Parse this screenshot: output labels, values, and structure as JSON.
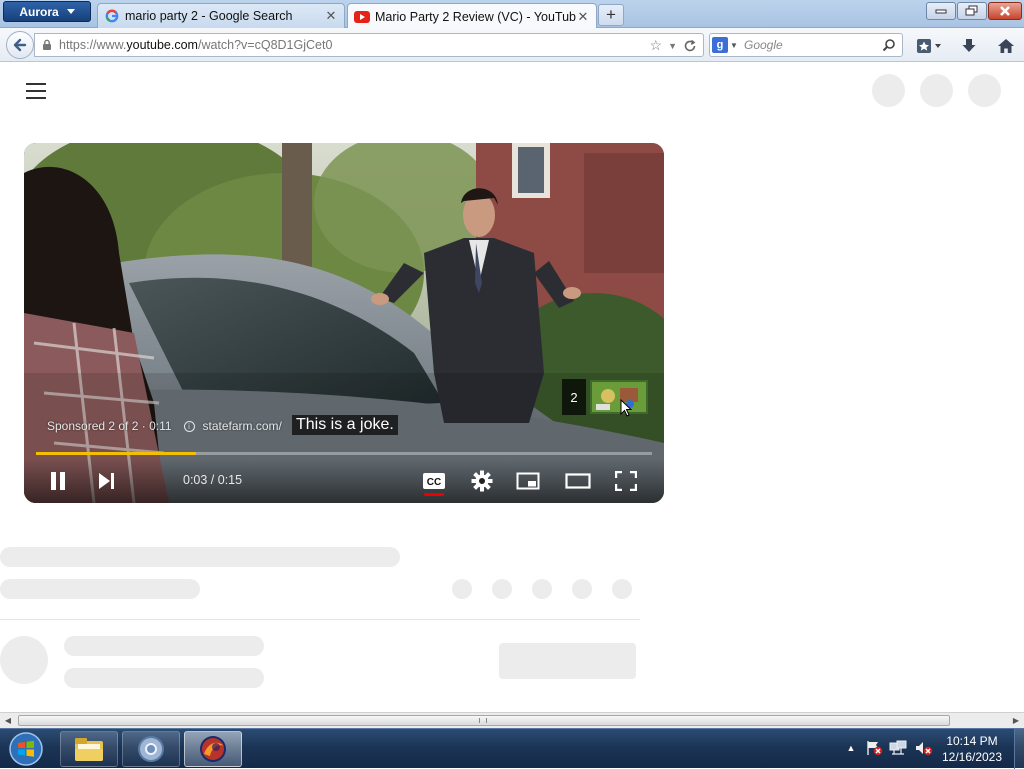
{
  "browser": {
    "menu_button": "Aurora",
    "tabs": [
      {
        "title": "mario party 2 - Google Search",
        "favicon": "google-g-icon",
        "active": false
      },
      {
        "title": "Mario Party 2 Review (VC) - YouTube",
        "favicon": "youtube-icon",
        "active": true
      }
    ],
    "url_prefix": "https://www.",
    "url_domain": "youtube.com",
    "url_rest": "/watch?v=cQ8D1GjCet0",
    "search_placeholder": "Google"
  },
  "player": {
    "caption": "This is a joke.",
    "sponsored": "Sponsored 2 of 2 · 0:11",
    "advertiser": "statefarm.com/",
    "ad_count_badge": "2",
    "time_display": "0:03 / 0:15",
    "progress_fraction": 0.26,
    "captions_on": true
  },
  "taskbar": {
    "clock_time": "10:14 PM",
    "clock_date": "12/16/2023"
  },
  "colors": {
    "progress_ad": "#f2c000",
    "cc_active": "#e00000",
    "taskbar": "#1b3556"
  }
}
